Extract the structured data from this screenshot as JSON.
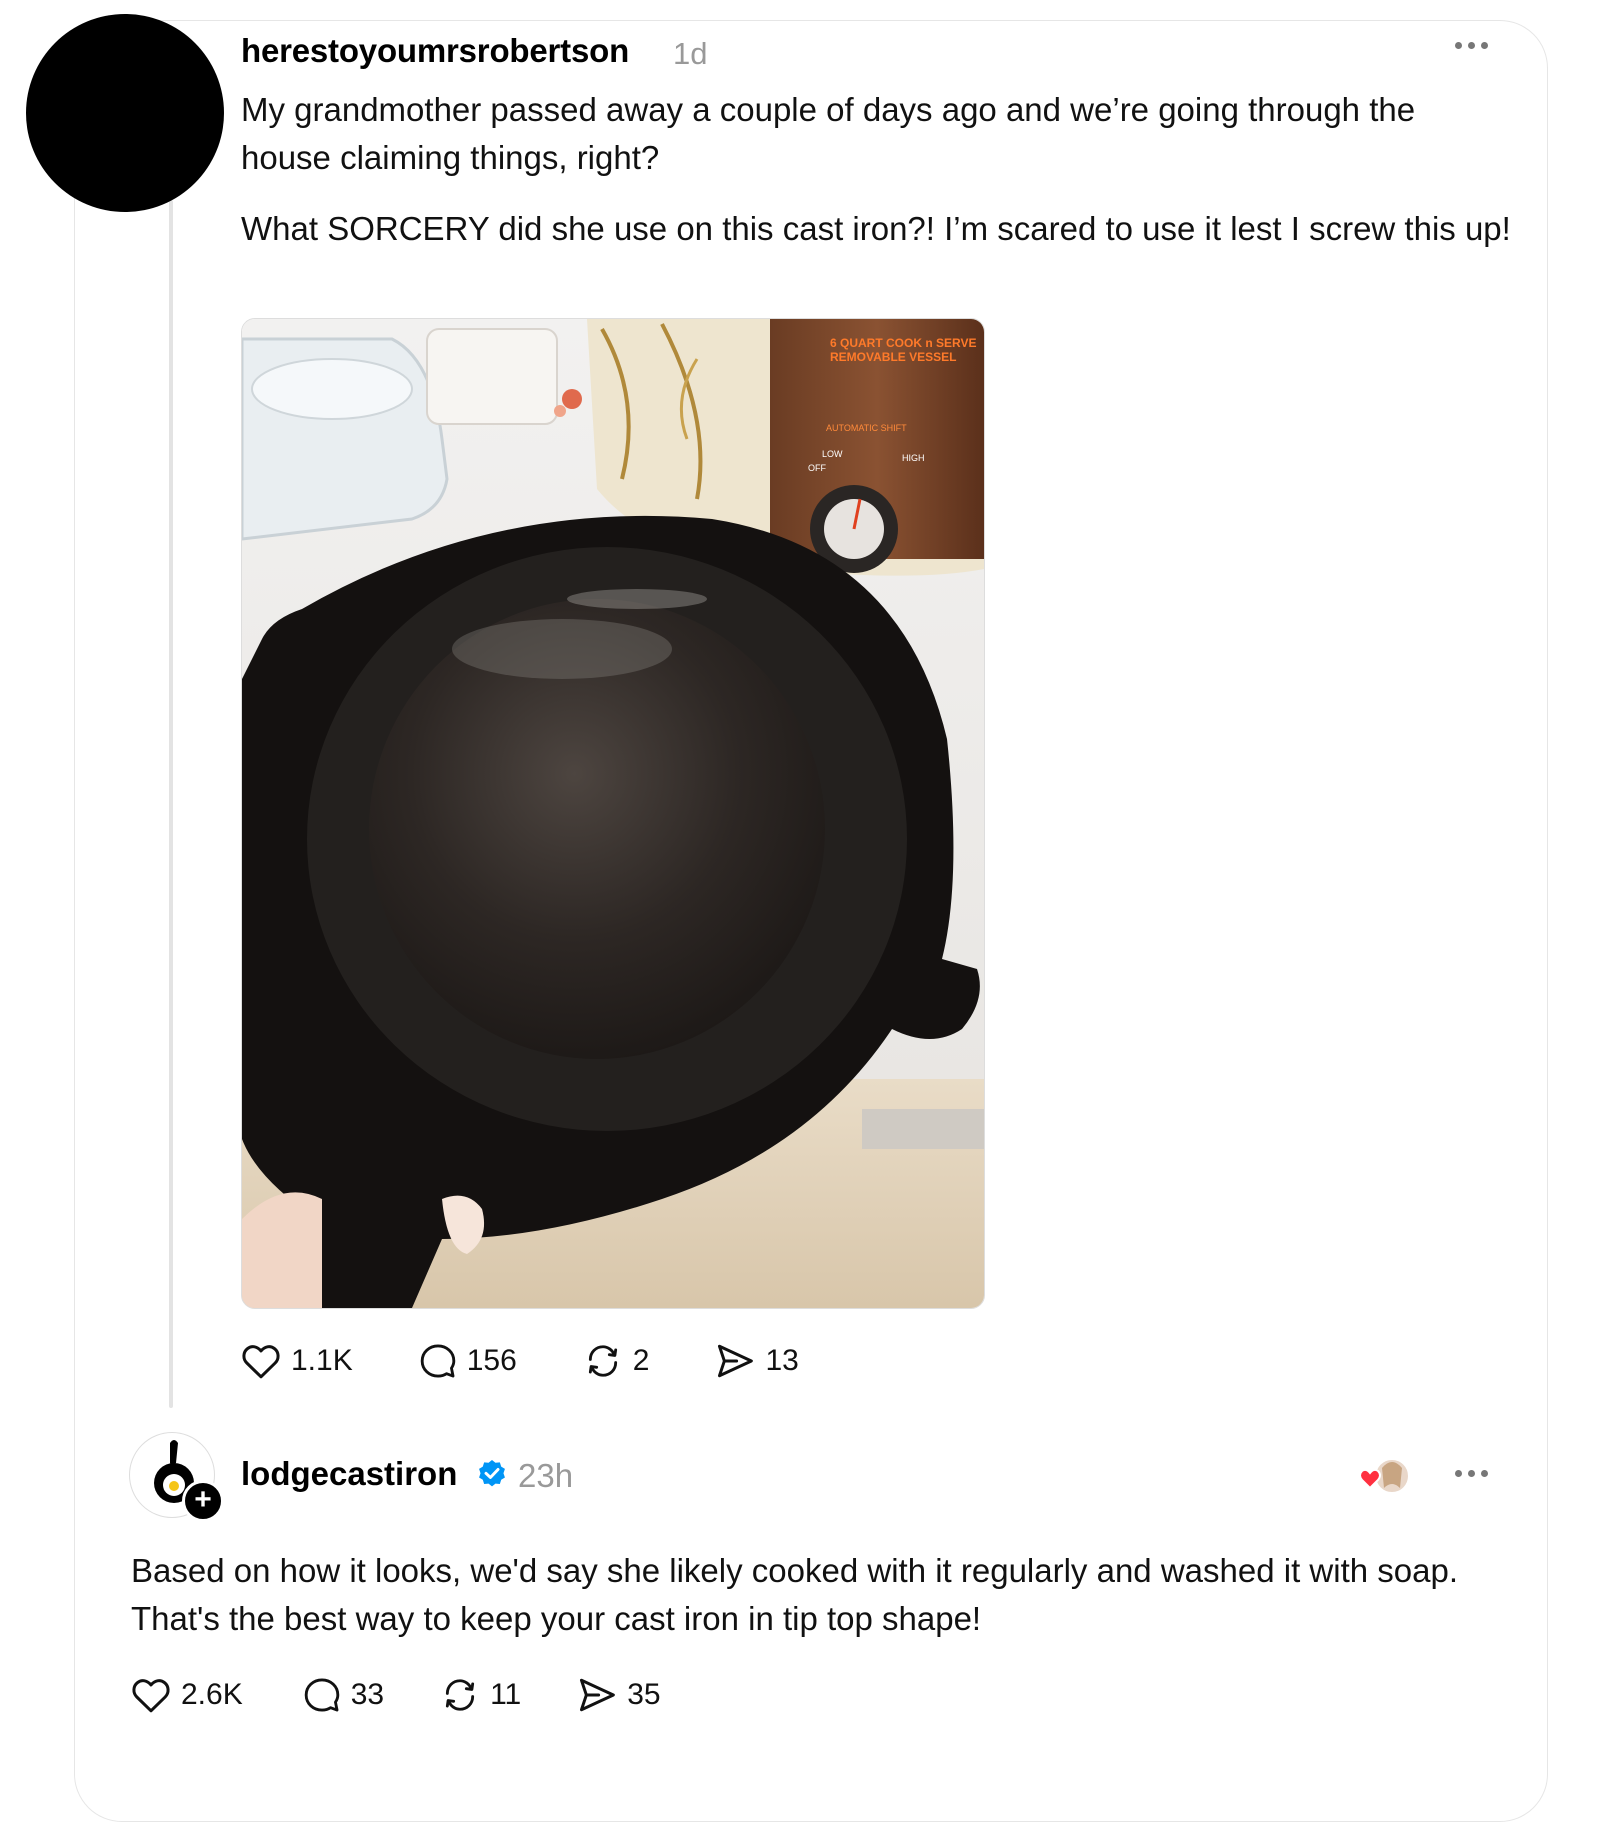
{
  "post": {
    "username": "herestoyoumrsrobertson",
    "time": "1d",
    "text_1": "My grandmother passed away a couple of days ago and we’re going through the house claiming things, right?",
    "text_2": "What SORCERY did she use on this cast iron?! I’m scared to use it lest I screw this up!",
    "image": {
      "description_icon": "cast-iron-skillet-photo",
      "label_lines": [
        "6 QUART COOK n SERVE",
        "REMOVABLE VESSEL",
        "AUTOMATIC SHIFT",
        "LOW",
        "OFF",
        "HIGH",
        "AUTO",
        "SHIFT"
      ]
    },
    "actions": {
      "likes": "1.1K",
      "comments": "156",
      "reposts": "2",
      "shares": "13"
    }
  },
  "reply": {
    "username": "lodgecastiron",
    "verified": true,
    "time": "23h",
    "text": "Based on how it looks, we'd say she likely cooked with it regularly and washed it with soap. That's the best way to keep your cast iron in tip top shape!",
    "actions": {
      "likes": "2.6K",
      "comments": "33",
      "reposts": "11",
      "shares": "35"
    }
  },
  "colors": {
    "verified": "#0095f6",
    "muted": "#999999",
    "heart": "#ff3040"
  }
}
